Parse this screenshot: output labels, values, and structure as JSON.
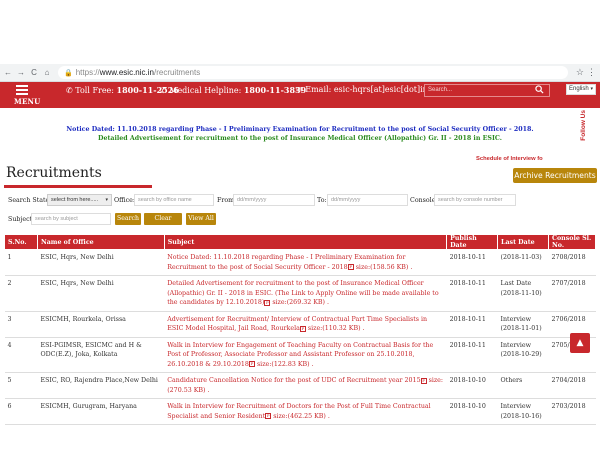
{
  "browser": {
    "back": "←",
    "forward": "→",
    "reload": "C",
    "home": "⌂",
    "url_scheme": "https://",
    "url_host": "www.esic.nic.in",
    "url_path": "/recruitments",
    "star": "☆",
    "menu": "⋮"
  },
  "header": {
    "menu_label": "MENU",
    "toll_free_label": "Toll Free:",
    "toll_free_number": "1800-11-2526",
    "helpline_label": "Medical Helpline:",
    "helpline_number": "1800-11-3839",
    "email_label": "Email:",
    "email_value": "esic-hqrs[at]esic[dot]in",
    "search_placeholder": "Search...",
    "language": "English",
    "follow_us": "Follow Us",
    "bar_color": "#c8282c"
  },
  "notices": {
    "notice_1": "Notice Dated: 11.10.2018 regarding Phase - I Preliminary Examination for Recruitment to the post of Social Security Officer - 2018.",
    "notice_2": "Detailed Advertisement for recruitment to the post of Insurance Medical Officer (Allopathic) Gr. II - 2018 in ESIC.",
    "marquee": "Schedule of Interview fo"
  },
  "page": {
    "title": "Recruitments",
    "archive_button": "Archive Recruitments"
  },
  "filters": {
    "search_states_label": "Search States:",
    "state_select_value": "select from here.....",
    "office_label": "Office:",
    "office_placeholder": "search by office name",
    "from_label": "From:",
    "from_placeholder": "dd/mm/yyyy",
    "to_label": "To:",
    "to_placeholder": "dd/mm/yyyy",
    "console_label": "Console:",
    "console_placeholder": "search by console number",
    "subject_label": "Subject:",
    "subject_placeholder": "search by subject",
    "search_button": "Search",
    "clear_button": "Clear Search",
    "view_all_button": "View All"
  },
  "table": {
    "headers": {
      "sno": "S.No.",
      "office": "Name of Office",
      "subject": "Subject",
      "publish": "Publish Date",
      "last": "Last Date",
      "console": "Console Sl. No."
    },
    "rows": [
      {
        "sno": "1",
        "office": "ESIC, Hqrs, New Delhi",
        "subject": "Notice Dated: 11.10.2018 regarding Phase - I Preliminary Examination for Recruitment to the post of Social Security Officer - 2018",
        "size": "size:(158.56 KB) .",
        "publish": "2018-10-11",
        "last_a": "",
        "last_b": "(2018-11-03)",
        "console": "2708/2018"
      },
      {
        "sno": "2",
        "office": "ESIC, Hqrs, New Delhi",
        "subject": "Detailed Advertisement for recruitment to the post of Insurance Medical Officer (Allopathic) Gr. II - 2018 in ESIC. (The Link to Apply Online will be made available to the candidates by 12.10.2018)",
        "size": "size:(269.32 KB) .",
        "publish": "2018-10-11",
        "last_a": "Last Date",
        "last_b": "(2018-11-10)",
        "console": "2707/2018"
      },
      {
        "sno": "3",
        "office": "ESICMH, Rourkela, Orissa",
        "subject": "Advertisement for Recruitment/ Interview of Contractual Part Time Specialists in ESIC Model Hospital, Jail Road, Rourkela",
        "size": "size:(110.32 KB) .",
        "publish": "2018-10-11",
        "last_a": "Interview",
        "last_b": "(2018-11-01)",
        "console": "2706/2018"
      },
      {
        "sno": "4",
        "office": "ESI-PGIMSR, ESICMC and H & ODC(E.Z), Joka, Kolkata",
        "subject": "Walk in Interview for Engagement of Teaching Faculty on Contractual Basis for the Post of Professor, Associate Professor and Assistant Professor on 25.10.2018, 26.10.2018 & 29.10.2018",
        "size": "size:(122.83 KB) .",
        "publish": "2018-10-11",
        "last_a": "Interview",
        "last_b": "(2018-10-29)",
        "console": "2705/2018"
      },
      {
        "sno": "5",
        "office": "ESIC, RO, Rajendra Place,New Delhi",
        "subject": "Candidature Cancellation Notice for the post of UDC of Recruitment year 2015",
        "size": "size:(270.53 KB) .",
        "publish": "2018-10-10",
        "last_a": "Others",
        "last_b": "",
        "console": "2704/2018"
      },
      {
        "sno": "6",
        "office": "ESICMH, Gurugram, Haryana",
        "subject": "Walk in Interview for Recruitment of Doctors for the Post of Full Time Contractual Specialist and Senior Resident",
        "size": "size:(462.25 KB) .",
        "publish": "2018-10-10",
        "last_a": "Interview",
        "last_b": "(2018-10-16)",
        "console": "2703/2018"
      }
    ]
  },
  "icons": {
    "phone": "phone-icon",
    "mobile": "mobile-icon",
    "email": "envelope-icon",
    "search": "search-icon",
    "pdf": "pdf-icon",
    "scroll_top": "chevron-up-icon",
    "pdf_glyph": "P",
    "scroll_glyph": "▲"
  }
}
